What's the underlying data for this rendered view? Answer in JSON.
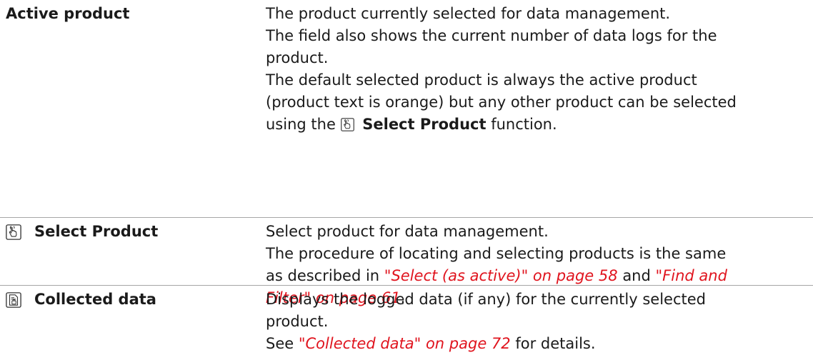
{
  "rows": [
    {
      "term": "Active product",
      "lines": [
        "The product currently selected for data management.",
        "The field also shows the current number of data logs for the",
        "product.",
        "The default selected product is always the active product",
        "(product text is orange) but any other product can be selected"
      ],
      "last_line_pre": "using the",
      "last_line_bold": "Select Product",
      "last_line_post": "function.",
      "inline_icon": "hand-pointer-icon"
    },
    {
      "icon": "hand-pointer-icon",
      "term": "Select Product",
      "line1": "Select product for data management.",
      "line2": "The procedure of locating and selecting products is the same",
      "line3_pre": "as described in",
      "ref1": "\"Select (as active)\" on page 58",
      "line3_mid": "and",
      "ref2_part1": "\"Find and",
      "ref2_part2": "Filter\" on page 61",
      "line4_post": "."
    },
    {
      "icon": "data-document-icon",
      "term": "Collected data",
      "line1": "Displays the logged data (if any) for the currently selected",
      "line2": "product.",
      "line3_pre": "See",
      "ref": "\"Collected data\" on page 72",
      "line3_post": "for details."
    }
  ],
  "colors": {
    "reference": "#e0141e",
    "divider": "#a6a6a6",
    "text": "#1a1a1a"
  }
}
